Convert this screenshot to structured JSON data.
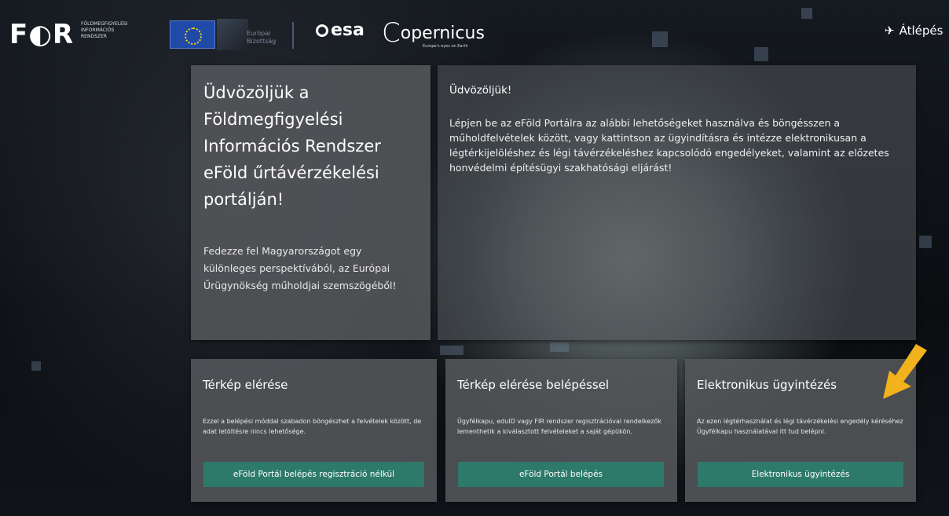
{
  "header": {
    "for_logo": "F◐R",
    "for_subtitle": [
      "FÖLDMEGFIGYELÉSI",
      "INFORMÁCIÓS",
      "RENDSZER"
    ],
    "eu_text": [
      "Európai",
      "Bizottság"
    ],
    "esa": "esa",
    "copernicus": "opernicus",
    "copernicus_c": "C",
    "copernicus_sub": "Europe's eyes on Earth",
    "login_label": "Átlépés"
  },
  "welcome": {
    "title": "Üdvözöljük a Földmegfigyelési Információs Rendszer eFöld űrtávérzékelési portálján!",
    "text": "Fedezze fel Magyarországot egy különleges perspektívából, az Európai Űrügynökség műholdjai szemszögéből!"
  },
  "intro": {
    "title": "Üdvözöljük!",
    "text": "Lépjen be az eFöld Portálra az alábbi lehetőségeket használva és böngésszen a műholdfelvételek között, vagy kattintson az ügyindításra és intézze elektronikusan a légtérkijelöléshez és légi távérzékeléshez kapcsolódó engedélyeket, valamint az előzetes honvédelmi építésügyi szakhatósági eljárást!"
  },
  "cards": [
    {
      "title": "Térkép elérése",
      "text": "Ezzel a belépési móddal szabadon böngészhet a felvételek között, de adat letöltésre nincs lehetősége.",
      "button": "eFöld Portál belépés regisztráció nélkül"
    },
    {
      "title": "Térkép elérése belépéssel",
      "text": "Ügyfélkapu, eduID vagy FIR rendszer regisztrációval rendelkezők lementhetik a kiválasztott felvételeket a saját gépükön.",
      "button": "eFöld Portál belépés"
    },
    {
      "title": "Elektronikus ügyintézés",
      "text": "Az ezen légtérhasználat és légi távérzékelési engedély kéréséhez Ügyfélkapu használatával itt tud belépni.",
      "button": "Elektronikus ügyintézés"
    }
  ],
  "colors": {
    "button": "#2e7a6a",
    "card": "#54565a",
    "arrow": "#f2b21c"
  }
}
